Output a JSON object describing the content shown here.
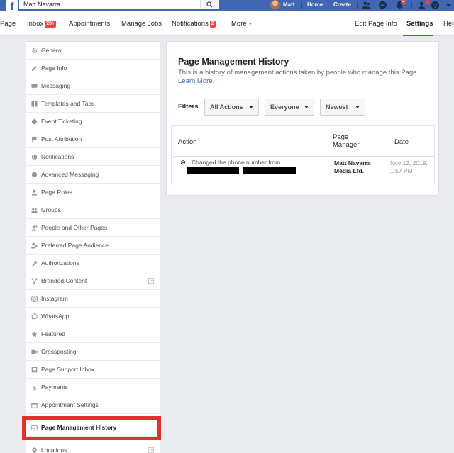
{
  "topbar": {
    "logo": "f",
    "search_value": "Matt Navarra",
    "user_name": "Matt",
    "home": "Home",
    "create": "Create",
    "notification_count": "2"
  },
  "page_nav": {
    "items": [
      {
        "label": "Page"
      },
      {
        "label": "Inbox",
        "badge": "20+"
      },
      {
        "label": "Appointments"
      },
      {
        "label": "Manage Jobs"
      },
      {
        "label": "Notifications",
        "badge": "2"
      },
      {
        "label": "More"
      }
    ],
    "right_items": [
      {
        "label": "Edit Page Info"
      },
      {
        "label": "Settings"
      },
      {
        "label": "Help"
      }
    ]
  },
  "sidebar": {
    "items": [
      {
        "label": "General",
        "icon": "gear-icon"
      },
      {
        "label": "Page Info",
        "icon": "pencil-icon"
      },
      {
        "label": "Messaging",
        "icon": "chat-icon"
      },
      {
        "label": "Templates and Tabs",
        "icon": "grid-icon"
      },
      {
        "label": "Event Ticketing",
        "icon": "ticket-icon"
      },
      {
        "label": "Post Attribution",
        "icon": "flag-icon"
      },
      {
        "label": "Notifications",
        "icon": "globe-icon"
      },
      {
        "label": "Advanced Messaging",
        "icon": "chat-bubble-icon"
      },
      {
        "label": "Page Roles",
        "icon": "person-icon"
      },
      {
        "label": "Groups",
        "icon": "people-icon"
      },
      {
        "label": "People and Other Pages",
        "icon": "person-plus-icon"
      },
      {
        "label": "Preferred Page Audience",
        "icon": "audience-icon"
      },
      {
        "label": "Authorizations",
        "icon": "wrench-icon"
      },
      {
        "label": "Branded Content",
        "icon": "handshake-icon"
      },
      {
        "label": "Instagram",
        "icon": "instagram-icon"
      },
      {
        "label": "WhatsApp",
        "icon": "whatsapp-icon"
      },
      {
        "label": "Featured",
        "icon": "star-icon"
      },
      {
        "label": "Crossposting",
        "icon": "video-icon"
      },
      {
        "label": "Page Support Inbox",
        "icon": "inbox-icon"
      },
      {
        "label": "Payments",
        "icon": "dollar-icon"
      },
      {
        "label": "Appointment Settings",
        "icon": "calendar-icon"
      },
      {
        "label": "Page Management History",
        "icon": "history-icon"
      },
      {
        "label": "Locations",
        "icon": "location-icon"
      }
    ],
    "selected_index": 21
  },
  "main": {
    "title": "Page Management History",
    "description": "This is a history of management actions taken by people who manage this Page.",
    "learn_more": "Learn More.",
    "filters_label": "Filters",
    "filters": [
      "All Actions",
      "Everyone",
      "Newest"
    ],
    "table": {
      "headers": {
        "action": "Action",
        "manager": "Page Manager",
        "date": "Date"
      },
      "rows": [
        {
          "action": "Changed the phone number from",
          "manager": "Matt Navarra Media Ltd.",
          "date": "Nov 12, 2019, 1:57 PM"
        }
      ]
    }
  },
  "colors": {
    "brand_blue": "#4267b2",
    "highlight_red": "#e4302b",
    "badge_red": "#fa3e3e"
  }
}
